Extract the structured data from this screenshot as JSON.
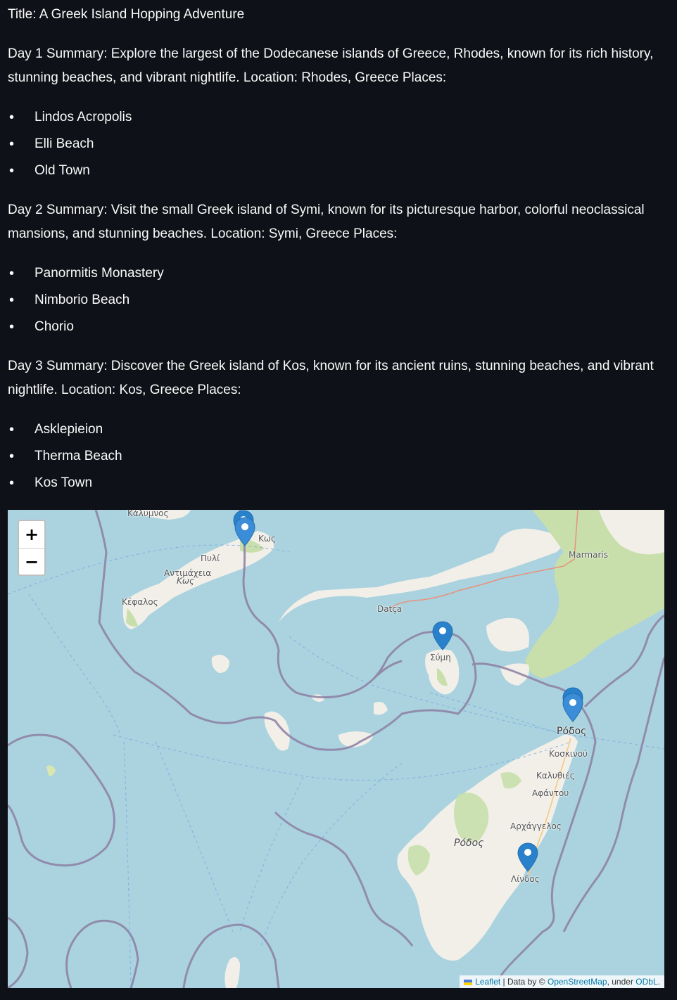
{
  "title": "Title: A Greek Island Hopping Adventure",
  "days": [
    {
      "summary": "Day 1 Summary: Explore the largest of the Dodecanese islands of Greece, Rhodes, known for its rich history, stunning beaches, and vibrant nightlife. Location: Rhodes, Greece Places:",
      "places": [
        "Lindos Acropolis",
        "Elli Beach",
        "Old Town"
      ]
    },
    {
      "summary": "Day 2 Summary: Visit the small Greek island of Symi, known for its picturesque harbor, colorful neoclassical mansions, and stunning beaches. Location: Symi, Greece Places:",
      "places": [
        "Panormitis Monastery",
        "Nimborio Beach",
        "Chorio"
      ]
    },
    {
      "summary": "Day 3 Summary: Discover the Greek island of Kos, known for its ancient ruins, stunning beaches, and vibrant nightlife. Location: Kos, Greece Places:",
      "places": [
        "Asklepieion",
        "Therma Beach",
        "Kos Town"
      ]
    }
  ],
  "map": {
    "zoom_in": "+",
    "zoom_out": "−",
    "labels": {
      "kalymnos": "Κάλυμνος",
      "pyli": "Πυλί",
      "antimacheia": "Αντιμάχεια",
      "kos": "Κως",
      "kos_town": "Κως",
      "kefalos": "Κέφαλος",
      "datca": "Datça",
      "marmaris": "Marmaris",
      "symi": "Σύμη",
      "rodos_town": "Ρόδος",
      "koskinou": "Κοσκινού",
      "kalythies": "Καλυθιές",
      "afantou": "Αφάντου",
      "archangelos": "Αρχάγγελος",
      "rodos_island": "Ρόδος",
      "lindos": "Λίνδος"
    },
    "markers": [
      "Kos Town",
      "Symi",
      "Rhodes Town",
      "Lindos"
    ],
    "attribution": {
      "leaflet": "Leaflet",
      "sep": " | Data by © ",
      "osm": "OpenStreetMap",
      "under": ", under ",
      "odbl": "ODbL",
      "end": "."
    },
    "colors": {
      "water": "#aad3df",
      "land": "#f2efe9",
      "forest": "#c8dfab",
      "border": "#8d7fa3",
      "marker": "#2a81cb"
    }
  }
}
